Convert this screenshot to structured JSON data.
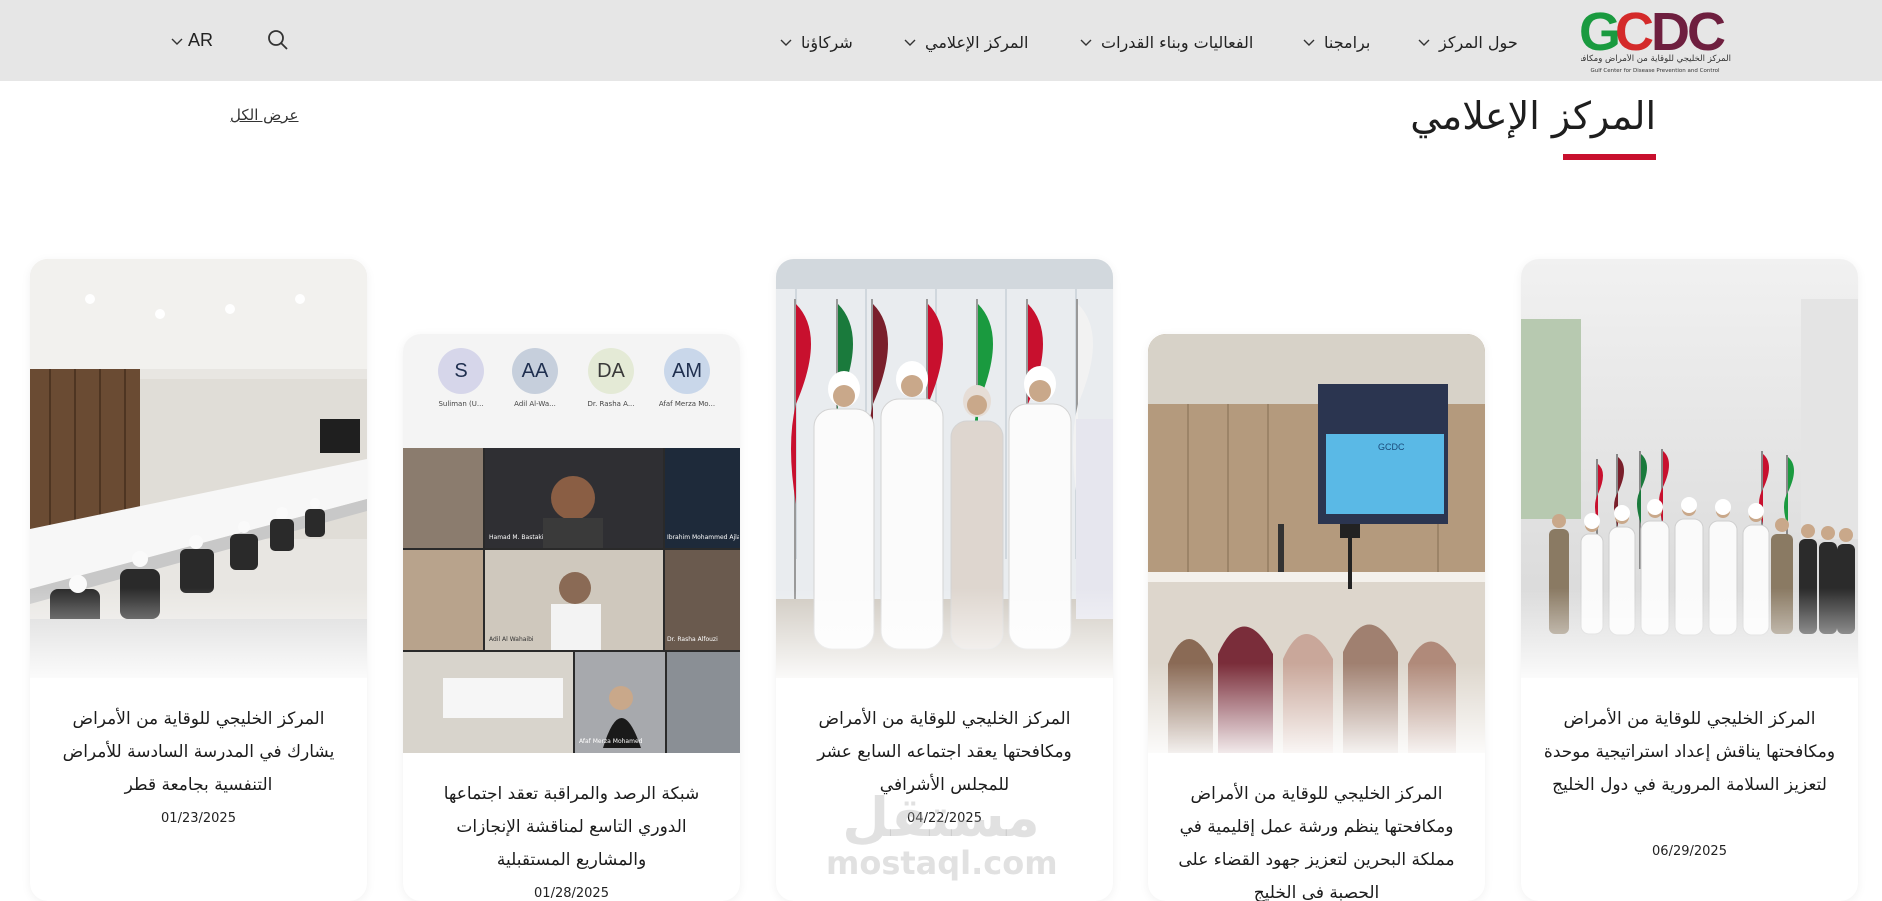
{
  "header": {
    "logo_text": "GCDC",
    "logo_subtitle_ar": "المركز الخليجي للوقاية من الأمراض ومكافحتها",
    "logo_subtitle_en": "Gulf Center for Disease Prevention and Control",
    "nav": [
      {
        "label": "حول المركز"
      },
      {
        "label": "برامجنا"
      },
      {
        "label": "الفعاليات وبناء القدرات"
      },
      {
        "label": "المركز الإعلامي"
      },
      {
        "label": "شركاؤنا"
      }
    ],
    "language": "AR"
  },
  "section": {
    "title": "المركز الإعلامي",
    "view_all": "عرض الكل"
  },
  "cards": [
    {
      "title": "المركز الخليجي للوقاية من الأمراض ومكافحتها يناقش إعداد استراتيجية موحدة لتعزيز السلامة المرورية في دول الخليج",
      "date": "06/29/2025"
    },
    {
      "title": "المركز الخليجي للوقاية من الأمراض ومكافحتها ينظم ورشة عمل إقليمية في مملكة البحرين لتعزيز جهود القضاء على الحصبة في الخليج",
      "date": ""
    },
    {
      "title": "المركز الخليجي للوقاية من الأمراض ومكافحتها يعقد اجتماعه السابع عشر للمجلس الأشرافي",
      "date": "04/22/2025"
    },
    {
      "title": "شبكة الرصد والمراقبة تعقد اجتماعها الدوري التاسع لمناقشة الإنجازات والمشاريع المستقبلية",
      "date": "01/28/2025"
    },
    {
      "title": "المركز الخليجي للوقاية من الأمراض يشارك في المدرسة السادسة للأمراض التنفسية بجامعة قطر",
      "date": "01/23/2025"
    }
  ],
  "video_call": {
    "participants": [
      {
        "initials": "AM",
        "name": "Afaf Merza Mo..."
      },
      {
        "initials": "DA",
        "name": "Dr. Rasha A..."
      },
      {
        "initials": "AA",
        "name": "Adil Al-Wa..."
      },
      {
        "initials": "S",
        "name": "Suliman (U..."
      }
    ],
    "tiles": [
      "Hamad M. Bastaki",
      "Ibrahim Mohammed Ajlan",
      "Adil Al Wahaibi",
      "Dr. Rasha Alfouzi",
      "Afaf Merza Mohamed"
    ]
  },
  "slide_screen_text": "GCDC",
  "watermark": {
    "ar": "مستقل",
    "en": "mostaql.com"
  },
  "colors": {
    "accent": "#c8102e",
    "header_bg": "#e6e6e6",
    "logo_green": "#1a9a3f",
    "logo_red": "#d42a2a",
    "logo_maroon": "#6e1f3f"
  }
}
